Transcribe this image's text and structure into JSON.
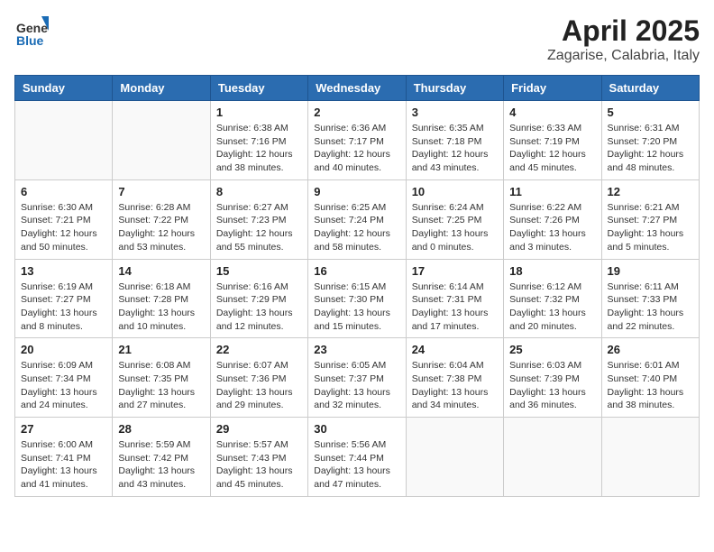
{
  "brand": {
    "name_general": "General",
    "name_blue": "Blue"
  },
  "title": {
    "month": "April 2025",
    "location": "Zagarise, Calabria, Italy"
  },
  "weekdays": [
    "Sunday",
    "Monday",
    "Tuesday",
    "Wednesday",
    "Thursday",
    "Friday",
    "Saturday"
  ],
  "weeks": [
    [
      {
        "day": "",
        "info": ""
      },
      {
        "day": "",
        "info": ""
      },
      {
        "day": "1",
        "info": "Sunrise: 6:38 AM\nSunset: 7:16 PM\nDaylight: 12 hours\nand 38 minutes."
      },
      {
        "day": "2",
        "info": "Sunrise: 6:36 AM\nSunset: 7:17 PM\nDaylight: 12 hours\nand 40 minutes."
      },
      {
        "day": "3",
        "info": "Sunrise: 6:35 AM\nSunset: 7:18 PM\nDaylight: 12 hours\nand 43 minutes."
      },
      {
        "day": "4",
        "info": "Sunrise: 6:33 AM\nSunset: 7:19 PM\nDaylight: 12 hours\nand 45 minutes."
      },
      {
        "day": "5",
        "info": "Sunrise: 6:31 AM\nSunset: 7:20 PM\nDaylight: 12 hours\nand 48 minutes."
      }
    ],
    [
      {
        "day": "6",
        "info": "Sunrise: 6:30 AM\nSunset: 7:21 PM\nDaylight: 12 hours\nand 50 minutes."
      },
      {
        "day": "7",
        "info": "Sunrise: 6:28 AM\nSunset: 7:22 PM\nDaylight: 12 hours\nand 53 minutes."
      },
      {
        "day": "8",
        "info": "Sunrise: 6:27 AM\nSunset: 7:23 PM\nDaylight: 12 hours\nand 55 minutes."
      },
      {
        "day": "9",
        "info": "Sunrise: 6:25 AM\nSunset: 7:24 PM\nDaylight: 12 hours\nand 58 minutes."
      },
      {
        "day": "10",
        "info": "Sunrise: 6:24 AM\nSunset: 7:25 PM\nDaylight: 13 hours\nand 0 minutes."
      },
      {
        "day": "11",
        "info": "Sunrise: 6:22 AM\nSunset: 7:26 PM\nDaylight: 13 hours\nand 3 minutes."
      },
      {
        "day": "12",
        "info": "Sunrise: 6:21 AM\nSunset: 7:27 PM\nDaylight: 13 hours\nand 5 minutes."
      }
    ],
    [
      {
        "day": "13",
        "info": "Sunrise: 6:19 AM\nSunset: 7:27 PM\nDaylight: 13 hours\nand 8 minutes."
      },
      {
        "day": "14",
        "info": "Sunrise: 6:18 AM\nSunset: 7:28 PM\nDaylight: 13 hours\nand 10 minutes."
      },
      {
        "day": "15",
        "info": "Sunrise: 6:16 AM\nSunset: 7:29 PM\nDaylight: 13 hours\nand 12 minutes."
      },
      {
        "day": "16",
        "info": "Sunrise: 6:15 AM\nSunset: 7:30 PM\nDaylight: 13 hours\nand 15 minutes."
      },
      {
        "day": "17",
        "info": "Sunrise: 6:14 AM\nSunset: 7:31 PM\nDaylight: 13 hours\nand 17 minutes."
      },
      {
        "day": "18",
        "info": "Sunrise: 6:12 AM\nSunset: 7:32 PM\nDaylight: 13 hours\nand 20 minutes."
      },
      {
        "day": "19",
        "info": "Sunrise: 6:11 AM\nSunset: 7:33 PM\nDaylight: 13 hours\nand 22 minutes."
      }
    ],
    [
      {
        "day": "20",
        "info": "Sunrise: 6:09 AM\nSunset: 7:34 PM\nDaylight: 13 hours\nand 24 minutes."
      },
      {
        "day": "21",
        "info": "Sunrise: 6:08 AM\nSunset: 7:35 PM\nDaylight: 13 hours\nand 27 minutes."
      },
      {
        "day": "22",
        "info": "Sunrise: 6:07 AM\nSunset: 7:36 PM\nDaylight: 13 hours\nand 29 minutes."
      },
      {
        "day": "23",
        "info": "Sunrise: 6:05 AM\nSunset: 7:37 PM\nDaylight: 13 hours\nand 32 minutes."
      },
      {
        "day": "24",
        "info": "Sunrise: 6:04 AM\nSunset: 7:38 PM\nDaylight: 13 hours\nand 34 minutes."
      },
      {
        "day": "25",
        "info": "Sunrise: 6:03 AM\nSunset: 7:39 PM\nDaylight: 13 hours\nand 36 minutes."
      },
      {
        "day": "26",
        "info": "Sunrise: 6:01 AM\nSunset: 7:40 PM\nDaylight: 13 hours\nand 38 minutes."
      }
    ],
    [
      {
        "day": "27",
        "info": "Sunrise: 6:00 AM\nSunset: 7:41 PM\nDaylight: 13 hours\nand 41 minutes."
      },
      {
        "day": "28",
        "info": "Sunrise: 5:59 AM\nSunset: 7:42 PM\nDaylight: 13 hours\nand 43 minutes."
      },
      {
        "day": "29",
        "info": "Sunrise: 5:57 AM\nSunset: 7:43 PM\nDaylight: 13 hours\nand 45 minutes."
      },
      {
        "day": "30",
        "info": "Sunrise: 5:56 AM\nSunset: 7:44 PM\nDaylight: 13 hours\nand 47 minutes."
      },
      {
        "day": "",
        "info": ""
      },
      {
        "day": "",
        "info": ""
      },
      {
        "day": "",
        "info": ""
      }
    ]
  ]
}
